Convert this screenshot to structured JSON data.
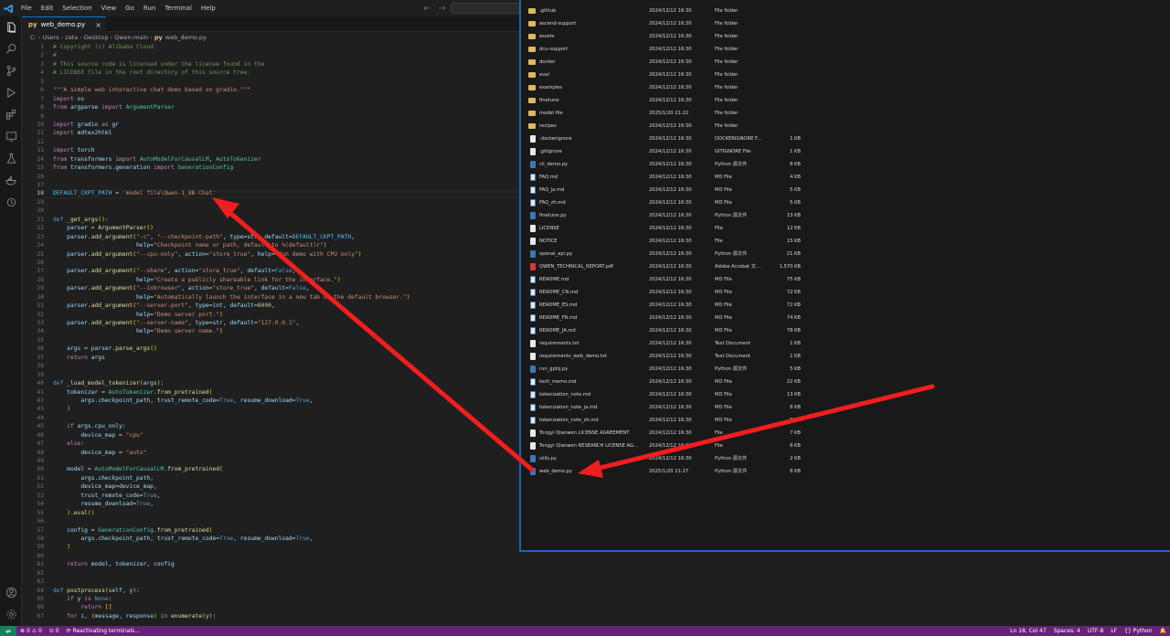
{
  "menubar": {
    "items": [
      "File",
      "Edit",
      "Selection",
      "View",
      "Go",
      "Run",
      "Terminal",
      "Help"
    ]
  },
  "tab": {
    "label": "web_demo.py",
    "close": "×"
  },
  "breadcrumb": [
    "C:",
    "Users",
    "zata",
    "Desktop",
    "Qwen-main",
    "web_demo.py"
  ],
  "editor": {
    "current_line": 18,
    "lines": [
      "# Copyright (c) Alibaba Cloud.",
      "#",
      "# This source code is licensed under the license found in the",
      "# LICENSE file in the root directory of this source tree.",
      "",
      "\"\"\"A simple web interactive chat demo based on gradio.\"\"\"",
      "import os",
      "from argparse import ArgumentParser",
      "",
      "import gradio as gr",
      "import mdtex2html",
      "",
      "import torch",
      "from transformers import AutoModelForCausalLM, AutoTokenizer",
      "from transformers.generation import GenerationConfig",
      "",
      "",
      "DEFAULT_CKPT_PATH = 'model file\\Qwen-1_8B-Chat'",
      "",
      "",
      "def _get_args():",
      "    parser = ArgumentParser()",
      "    parser.add_argument(\"-c\", \"--checkpoint-path\", type=str, default=DEFAULT_CKPT_PATH,",
      "                        help=\"Checkpoint name or path, default to %(default)r\")",
      "    parser.add_argument(\"--cpu-only\", action=\"store_true\", help=\"Run demo with CPU only\")",
      "",
      "    parser.add_argument(\"--share\", action=\"store_true\", default=False,",
      "                        help=\"Create a publicly shareable link for the interface.\")",
      "    parser.add_argument(\"--inbrowser\", action=\"store_true\", default=False,",
      "                        help=\"Automatically launch the interface in a new tab on the default browser.\")",
      "    parser.add_argument(\"--server-port\", type=int, default=8000,",
      "                        help=\"Demo server port.\")",
      "    parser.add_argument(\"--server-name\", type=str, default=\"127.0.0.1\",",
      "                        help=\"Demo server name.\")",
      "",
      "    args = parser.parse_args()",
      "    return args",
      "",
      "",
      "def _load_model_tokenizer(args):",
      "    tokenizer = AutoTokenizer.from_pretrained(",
      "        args.checkpoint_path, trust_remote_code=True, resume_download=True,",
      "    )",
      "",
      "    if args.cpu_only:",
      "        device_map = \"cpu\"",
      "    else:",
      "        device_map = \"auto\"",
      "",
      "    model = AutoModelForCausalLM.from_pretrained(",
      "        args.checkpoint_path,",
      "        device_map=device_map,",
      "        trust_remote_code=True,",
      "        resume_download=True,",
      "    ).eval()",
      "",
      "    config = GenerationConfig.from_pretrained(",
      "        args.checkpoint_path, trust_remote_code=True, resume_download=True,",
      "    )",
      "",
      "    return model, tokenizer, config",
      "",
      "",
      "def postprocess(self, y):",
      "    if y is None:",
      "        return []",
      "    for i, (message, response) in enumerate(y):"
    ]
  },
  "explorer": {
    "files": [
      {
        "name": ".github",
        "date": "2024/12/12 16:30",
        "type": "File folder",
        "size": "",
        "kind": "folder"
      },
      {
        "name": "ascend-support",
        "date": "2024/12/12 16:30",
        "type": "File folder",
        "size": "",
        "kind": "folder"
      },
      {
        "name": "assets",
        "date": "2024/12/12 16:30",
        "type": "File folder",
        "size": "",
        "kind": "folder"
      },
      {
        "name": "dcu-support",
        "date": "2024/12/12 16:30",
        "type": "File folder",
        "size": "",
        "kind": "folder"
      },
      {
        "name": "docker",
        "date": "2024/12/12 16:30",
        "type": "File folder",
        "size": "",
        "kind": "folder"
      },
      {
        "name": "eval",
        "date": "2024/12/12 16:30",
        "type": "File folder",
        "size": "",
        "kind": "folder"
      },
      {
        "name": "examples",
        "date": "2024/12/12 16:30",
        "type": "File folder",
        "size": "",
        "kind": "folder"
      },
      {
        "name": "finetune",
        "date": "2024/12/12 16:30",
        "type": "File folder",
        "size": "",
        "kind": "folder"
      },
      {
        "name": "model file",
        "date": "2025/1/20 21:22",
        "type": "File folder",
        "size": "",
        "kind": "folder"
      },
      {
        "name": "recipes",
        "date": "2024/12/12 16:30",
        "type": "File folder",
        "size": "",
        "kind": "folder"
      },
      {
        "name": ".dockerignore",
        "date": "2024/12/12 16:30",
        "type": "DOCKERIGNORE F...",
        "size": "1 KB",
        "kind": "doc"
      },
      {
        "name": ".gitignore",
        "date": "2024/12/12 16:30",
        "type": "GITIGNORE File",
        "size": "1 KB",
        "kind": "doc"
      },
      {
        "name": "cli_demo.py",
        "date": "2024/12/12 16:30",
        "type": "Python 源文件",
        "size": "8 KB",
        "kind": "py"
      },
      {
        "name": "FAQ.md",
        "date": "2024/12/12 16:30",
        "type": "MD File",
        "size": "4 KB",
        "kind": "md"
      },
      {
        "name": "FAQ_ja.md",
        "date": "2024/12/12 16:30",
        "type": "MD File",
        "size": "5 KB",
        "kind": "md"
      },
      {
        "name": "FAQ_zh.md",
        "date": "2024/12/12 16:30",
        "type": "MD File",
        "size": "5 KB",
        "kind": "md"
      },
      {
        "name": "finetune.py",
        "date": "2024/12/12 16:30",
        "type": "Python 源文件",
        "size": "13 KB",
        "kind": "py"
      },
      {
        "name": "LICENSE",
        "date": "2024/12/12 16:30",
        "type": "File",
        "size": "12 KB",
        "kind": "doc"
      },
      {
        "name": "NOTICE",
        "date": "2024/12/12 16:30",
        "type": "File",
        "size": "15 KB",
        "kind": "doc"
      },
      {
        "name": "openai_api.py",
        "date": "2024/12/12 16:30",
        "type": "Python 源文件",
        "size": "21 KB",
        "kind": "py"
      },
      {
        "name": "QWEN_TECHNICAL_REPORT.pdf",
        "date": "2024/12/12 16:30",
        "type": "Adobe Acrobat 文...",
        "size": "1,570 KB",
        "kind": "pdf"
      },
      {
        "name": "README.md",
        "date": "2024/12/12 16:30",
        "type": "MD File",
        "size": "75 KB",
        "kind": "md"
      },
      {
        "name": "README_CN.md",
        "date": "2024/12/12 16:30",
        "type": "MD File",
        "size": "72 KB",
        "kind": "md"
      },
      {
        "name": "README_ES.md",
        "date": "2024/12/12 16:30",
        "type": "MD File",
        "size": "72 KB",
        "kind": "md"
      },
      {
        "name": "README_FR.md",
        "date": "2024/12/12 16:30",
        "type": "MD File",
        "size": "74 KB",
        "kind": "md"
      },
      {
        "name": "README_JA.md",
        "date": "2024/12/12 16:30",
        "type": "MD File",
        "size": "78 KB",
        "kind": "md"
      },
      {
        "name": "requirements.txt",
        "date": "2024/12/12 16:30",
        "type": "Text Document",
        "size": "1 KB",
        "kind": "doc"
      },
      {
        "name": "requirements_web_demo.txt",
        "date": "2024/12/12 16:30",
        "type": "Text Document",
        "size": "1 KB",
        "kind": "doc"
      },
      {
        "name": "run_gptq.py",
        "date": "2024/12/12 16:30",
        "type": "Python 源文件",
        "size": "5 KB",
        "kind": "py"
      },
      {
        "name": "tech_memo.md",
        "date": "2024/12/12 16:30",
        "type": "MD File",
        "size": "22 KB",
        "kind": "md"
      },
      {
        "name": "tokenization_note.md",
        "date": "2024/12/12 16:30",
        "type": "MD File",
        "size": "13 KB",
        "kind": "md"
      },
      {
        "name": "tokenization_note_ja.md",
        "date": "2024/12/12 16:30",
        "type": "MD File",
        "size": "8 KB",
        "kind": "md"
      },
      {
        "name": "tokenization_note_zh.md",
        "date": "2024/12/12 16:30",
        "type": "MD File",
        "size": "8 KB",
        "kind": "md"
      },
      {
        "name": "Tongyi Qianwen LICENSE AGREEMENT",
        "date": "2024/12/12 16:30",
        "type": "File",
        "size": "7 KB",
        "kind": "doc"
      },
      {
        "name": "Tongyi Qianwen RESEARCH LICENSE AG...",
        "date": "2024/12/12 16:30",
        "type": "File",
        "size": "8 KB",
        "kind": "doc"
      },
      {
        "name": "utils.py",
        "date": "2024/12/12 16:30",
        "type": "Python 源文件",
        "size": "2 KB",
        "kind": "py"
      },
      {
        "name": "web_demo.py",
        "date": "2025/1/20 21:27",
        "type": "Python 源文件",
        "size": "8 KB",
        "kind": "py"
      }
    ]
  },
  "statusbar": {
    "errors": "0",
    "warnings": "0",
    "ports": "0",
    "activity": "Reactivating terminals...",
    "position": "Ln 18, Col 47",
    "spaces": "Spaces: 4",
    "encoding": "UTF-8",
    "eol": "LF",
    "language": "Python"
  },
  "colors": {
    "annotation": "#f01e1e",
    "accent": "#0078d4",
    "statusbar": "#68217a"
  }
}
